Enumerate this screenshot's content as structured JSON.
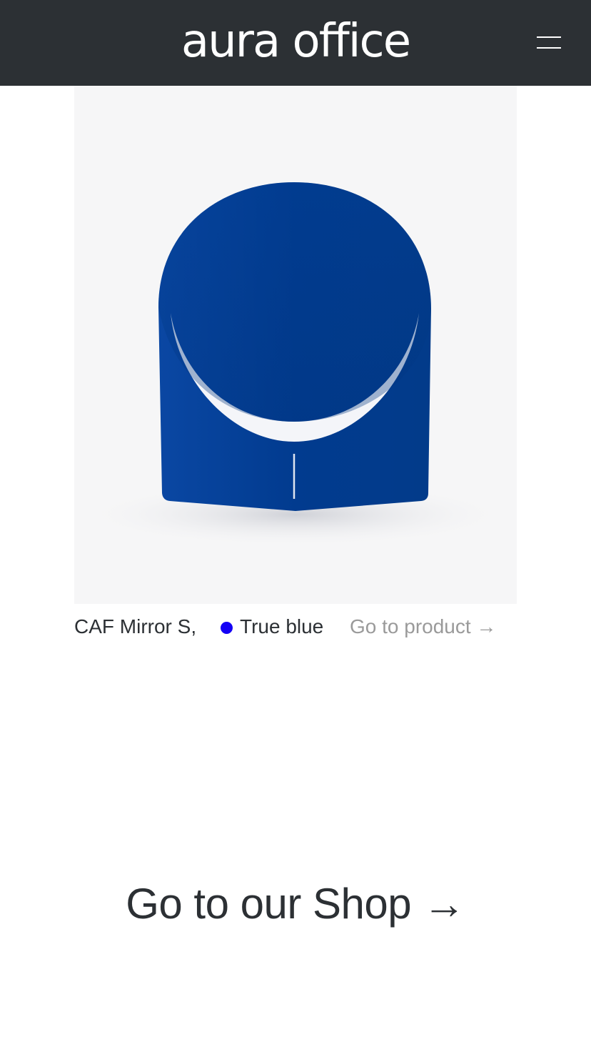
{
  "header": {
    "logo_text": "aura office",
    "background": "#2c3034",
    "menu_icon": "hamburger-menu-icon"
  },
  "product": {
    "image_subject": "CAF Mirror S",
    "name": "CAF Mirror S,",
    "color_name": "True blue",
    "color_swatch": "#1400f5",
    "product_color": "#013a8c",
    "link_label": "Go to product →"
  },
  "shop": {
    "link_label": "Go to our Shop →"
  }
}
